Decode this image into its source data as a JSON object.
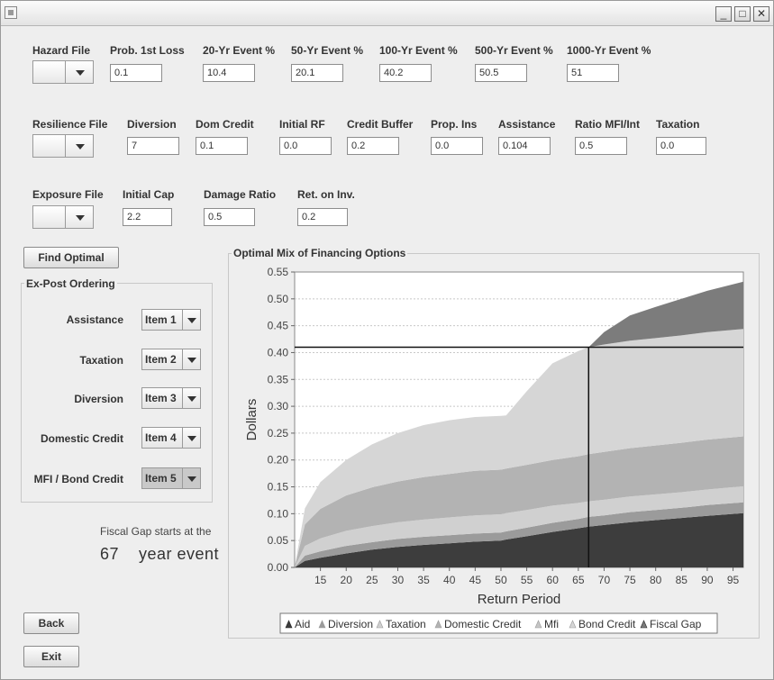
{
  "window": {
    "minimize_glyph": "_",
    "maximize_glyph": "□",
    "close_glyph": "✕"
  },
  "row1": {
    "hazard_file_label": "Hazard File",
    "fields": [
      {
        "label": "Prob. 1st Loss",
        "value": "0.1"
      },
      {
        "label": "20-Yr Event %",
        "value": "10.4"
      },
      {
        "label": "50-Yr Event %",
        "value": "20.1"
      },
      {
        "label": "100-Yr Event %",
        "value": "40.2"
      },
      {
        "label": "500-Yr Event %",
        "value": "50.5"
      },
      {
        "label": "1000-Yr Event %",
        "value": "51"
      }
    ]
  },
  "row2": {
    "resilience_file_label": "Resilience File",
    "fields": [
      {
        "label": "Diversion",
        "value": "7"
      },
      {
        "label": "Dom Credit",
        "value": "0.1"
      },
      {
        "label": "Initial RF",
        "value": "0.0"
      },
      {
        "label": "Credit Buffer",
        "value": "0.2"
      },
      {
        "label": "Prop. Ins",
        "value": "0.0"
      },
      {
        "label": "Assistance",
        "value": "0.104"
      },
      {
        "label": "Ratio MFI/Int",
        "value": "0.5"
      },
      {
        "label": "Taxation",
        "value": "0.0"
      }
    ]
  },
  "row3": {
    "exposure_file_label": "Exposure File",
    "fields": [
      {
        "label": "Initial Cap",
        "value": "2.2"
      },
      {
        "label": "Damage Ratio",
        "value": "0.5"
      },
      {
        "label": "Ret. on Inv.",
        "value": "0.2"
      }
    ]
  },
  "buttons": {
    "find_optimal": "Find Optimal",
    "back": "Back",
    "exit": "Exit"
  },
  "ordering": {
    "title": "Ex-Post Ordering",
    "rows": [
      {
        "label": "Assistance",
        "item": "Item 1"
      },
      {
        "label": "Taxation",
        "item": "Item 2"
      },
      {
        "label": "Diversion",
        "item": "Item 3"
      },
      {
        "label": "Domestic Credit",
        "item": "Item 4"
      },
      {
        "label": "MFI / Bond Credit",
        "item": "Item 5"
      }
    ]
  },
  "fiscal_gap": {
    "line1": "Fiscal Gap starts at the",
    "number": "67",
    "suffix": "year event"
  },
  "colors": {
    "aid": "#3d3d3d",
    "diversion": "#9b9b9b",
    "taxation": "#d0d0d0",
    "domestic_credit": "#b3b3b3",
    "mfi": "#c5c5c5",
    "bond_credit": "#d6d6d6",
    "fiscal_gap": "#7c7c7c"
  },
  "chart_data": {
    "type": "area",
    "title": "Optimal Mix of Financing Options",
    "xlabel": "Return Period",
    "ylabel": "Dollars",
    "xlim": [
      10,
      97
    ],
    "ylim": [
      0,
      0.55
    ],
    "xticks": [
      15,
      20,
      25,
      30,
      35,
      40,
      45,
      50,
      55,
      60,
      65,
      70,
      75,
      80,
      85,
      90,
      95
    ],
    "yticks": [
      "0.00",
      "0.05",
      "0.10",
      "0.15",
      "0.20",
      "0.25",
      "0.30",
      "0.35",
      "0.40",
      "0.45",
      "0.50",
      "0.55"
    ],
    "legend_position": "bottom",
    "grid": true,
    "x": [
      10,
      12,
      15,
      20,
      25,
      30,
      35,
      40,
      45,
      50,
      51,
      55,
      60,
      65,
      67,
      70,
      75,
      80,
      85,
      90,
      97
    ],
    "series": [
      {
        "name": "Aid",
        "color_key": "aid",
        "values": [
          0.0,
          0.012,
          0.018,
          0.026,
          0.033,
          0.038,
          0.042,
          0.045,
          0.048,
          0.05,
          0.052,
          0.058,
          0.066,
          0.073,
          0.076,
          0.079,
          0.084,
          0.088,
          0.092,
          0.096,
          0.101
        ]
      },
      {
        "name": "Diversion",
        "color_key": "diversion",
        "values": [
          0.0,
          0.01,
          0.012,
          0.014,
          0.014,
          0.015,
          0.015,
          0.015,
          0.015,
          0.015,
          0.015,
          0.016,
          0.017,
          0.017,
          0.018,
          0.018,
          0.019,
          0.019,
          0.019,
          0.02,
          0.02
        ]
      },
      {
        "name": "Taxation",
        "color_key": "taxation",
        "values": [
          0.0,
          0.018,
          0.024,
          0.028,
          0.03,
          0.031,
          0.032,
          0.033,
          0.034,
          0.034,
          0.034,
          0.033,
          0.032,
          0.03,
          0.029,
          0.029,
          0.029,
          0.029,
          0.029,
          0.029,
          0.03
        ]
      },
      {
        "name": "Domestic Credit",
        "color_key": "domestic_credit",
        "values": [
          0.0,
          0.04,
          0.055,
          0.066,
          0.072,
          0.076,
          0.079,
          0.081,
          0.083,
          0.083,
          0.083,
          0.084,
          0.085,
          0.087,
          0.088,
          0.089,
          0.09,
          0.091,
          0.092,
          0.093,
          0.093
        ]
      },
      {
        "name": "Mfi",
        "color_key": "mfi",
        "values": [
          0.0,
          0.0,
          0.0,
          0.0,
          0.0,
          0.0,
          0.0,
          0.0,
          0.0,
          0.0,
          0.0,
          0.0,
          0.0,
          0.0,
          0.0,
          0.0,
          0.0,
          0.0,
          0.0,
          0.0,
          0.0
        ]
      },
      {
        "name": "Bond Credit",
        "color_key": "bond_credit",
        "values": [
          0.0,
          0.03,
          0.05,
          0.066,
          0.08,
          0.09,
          0.097,
          0.1,
          0.1,
          0.1,
          0.099,
          0.137,
          0.18,
          0.196,
          0.199,
          0.2,
          0.2,
          0.2,
          0.2,
          0.2,
          0.2
        ]
      },
      {
        "name": "Fiscal Gap",
        "color_key": "fiscal_gap",
        "values": [
          0.0,
          0.0,
          0.0,
          0.0,
          0.0,
          0.0,
          0.0,
          0.0,
          0.0,
          0.0,
          0.0,
          0.0,
          0.0,
          0.0,
          0.0,
          0.023,
          0.047,
          0.058,
          0.068,
          0.077,
          0.088
        ]
      }
    ],
    "reference_lines": {
      "x": 67,
      "y": 0.41
    }
  }
}
